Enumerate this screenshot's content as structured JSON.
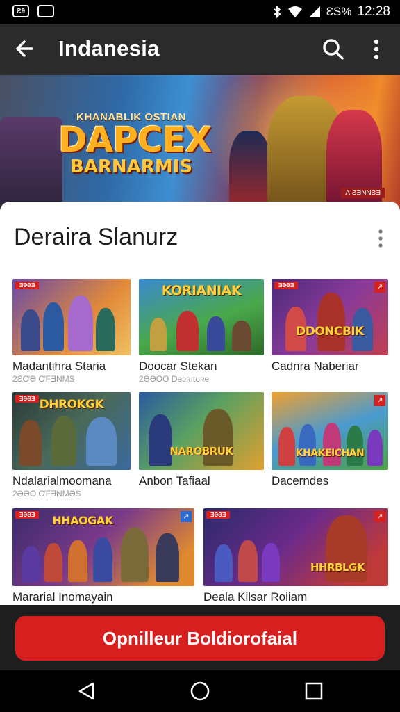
{
  "status_bar": {
    "left_icon_1": "Ƨ9",
    "left_icon_2": "message-icon",
    "battery": "ƐS%",
    "time": "12:28"
  },
  "app_bar": {
    "title": "Indanesia",
    "back_icon": "arrow-left-icon",
    "search_icon": "search-icon",
    "more_icon": "more-vert-icon"
  },
  "hero": {
    "logo_top": "KHANABLIK OSTIAN",
    "logo_main": "DAPCEX",
    "logo_sub": "BARNARMIS",
    "tag": "Ʌ ƧƎNNƧƎ"
  },
  "section": {
    "title": "Deraira Slanurz"
  },
  "cards": [
    {
      "title": "Madantihra Staria",
      "subtitle": "2ƧƠƏ ƠFƎNMS",
      "badge": "ƎƏƏƎ",
      "logo": ""
    },
    {
      "title": "Doocar Stekan",
      "subtitle": "2ƏƏOO Deɔʀıtʊʀe",
      "badge": "",
      "logo": "KORIANIAK"
    },
    {
      "title": "Cadnra Naberiar",
      "subtitle": "",
      "badge": "ƎƏƏƎ",
      "logo": "DDONCBIK"
    },
    {
      "title": "Ndalarialmoomana",
      "subtitle": "2ƏƏO ƠFƎNMƏS",
      "badge": "ƎƏƏƎ",
      "logo": "DHROKGK"
    },
    {
      "title": "Anbon Tafiaal",
      "subtitle": "",
      "badge": "",
      "logo": "NAROBRUK"
    },
    {
      "title": "Dacerndes",
      "subtitle": "",
      "badge": "",
      "logo": "KHAKEICHAN"
    },
    {
      "title": "Mararial Inomayain",
      "subtitle": "",
      "badge": "ƎƏƏƎ",
      "logo": "HHAOGAK"
    },
    {
      "title": "Deala Kilsar Roiiam",
      "subtitle": "",
      "badge": "ƎƏƏƎ",
      "logo": "HHRBLGK"
    }
  ],
  "cta": {
    "label": "Opnilleur Boldiorofaial"
  },
  "colors": {
    "accent": "#d81f1f",
    "app_bar": "#2b2b2b"
  },
  "nav": {
    "back": "nav-back-icon",
    "home": "nav-home-icon",
    "recents": "nav-recents-icon"
  }
}
